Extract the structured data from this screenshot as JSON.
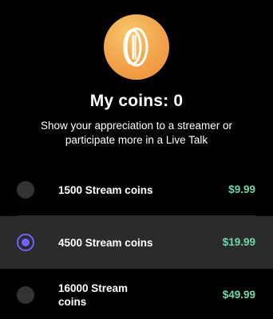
{
  "header": {
    "icon": "coin-icon",
    "title": "My coins: 0",
    "subtitle": "Show your appreciation to a streamer or participate more in a Live Talk"
  },
  "colors": {
    "background": "#000000",
    "selected_row": "#2b2b2b",
    "accent_radio": "#6e62ff",
    "price": "#6fd6a8",
    "coin_gradient_start": "#f7c86a",
    "coin_gradient_end": "#ef8d3c"
  },
  "options": [
    {
      "label": "1500 Stream coins",
      "price": "$9.99",
      "selected": false
    },
    {
      "label": "4500 Stream coins",
      "price": "$19.99",
      "selected": true
    },
    {
      "label": "16000 Stream coins",
      "price": "$49.99",
      "selected": false
    }
  ]
}
